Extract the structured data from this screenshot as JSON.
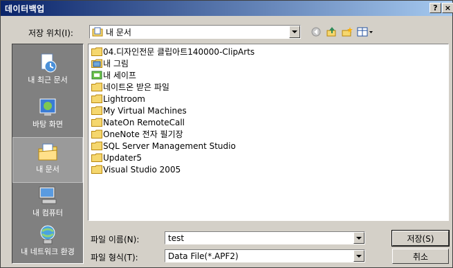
{
  "window": {
    "title": "데이터백업",
    "help_label": "?",
    "close_label": "×"
  },
  "lookin": {
    "label": "저장 위치(I):",
    "value": "내 문서"
  },
  "toolbar_icons": [
    "back-icon",
    "up-folder-icon",
    "new-folder-icon",
    "view-menu-icon"
  ],
  "places": [
    {
      "label": "내 최근 문서",
      "icon": "recent-documents-icon"
    },
    {
      "label": "바탕 화면",
      "icon": "desktop-icon"
    },
    {
      "label": "내 문서",
      "icon": "my-documents-icon"
    },
    {
      "label": "내 컴퓨터",
      "icon": "my-computer-icon"
    },
    {
      "label": "내 네트워크 환경",
      "icon": "network-icon"
    }
  ],
  "files": [
    {
      "name": "04.디자인전문 클립아트140000-ClipArts",
      "icon": "folder"
    },
    {
      "name": "내 그림",
      "icon": "pictures"
    },
    {
      "name": "내 세이프",
      "icon": "safe"
    },
    {
      "name": "네이트온 받은 파일",
      "icon": "folder"
    },
    {
      "name": "Lightroom",
      "icon": "folder"
    },
    {
      "name": "My Virtual Machines",
      "icon": "folder"
    },
    {
      "name": "NateOn RemoteCall",
      "icon": "folder"
    },
    {
      "name": "OneNote 전자 필기장",
      "icon": "folder"
    },
    {
      "name": "SQL Server Management Studio",
      "icon": "folder"
    },
    {
      "name": "Updater5",
      "icon": "folder"
    },
    {
      "name": "Visual Studio 2005",
      "icon": "folder"
    }
  ],
  "filename": {
    "label": "파일 이름(N):",
    "value": "test"
  },
  "filetype": {
    "label": "파일 형식(T):",
    "value": "Data File(*.APF2)"
  },
  "buttons": {
    "save": "저장(S)",
    "cancel": "취소"
  },
  "colors": {
    "title_start": "#0a246a",
    "title_end": "#a6caf0",
    "folder": "#f5d76e",
    "places_bg": "#808080"
  }
}
